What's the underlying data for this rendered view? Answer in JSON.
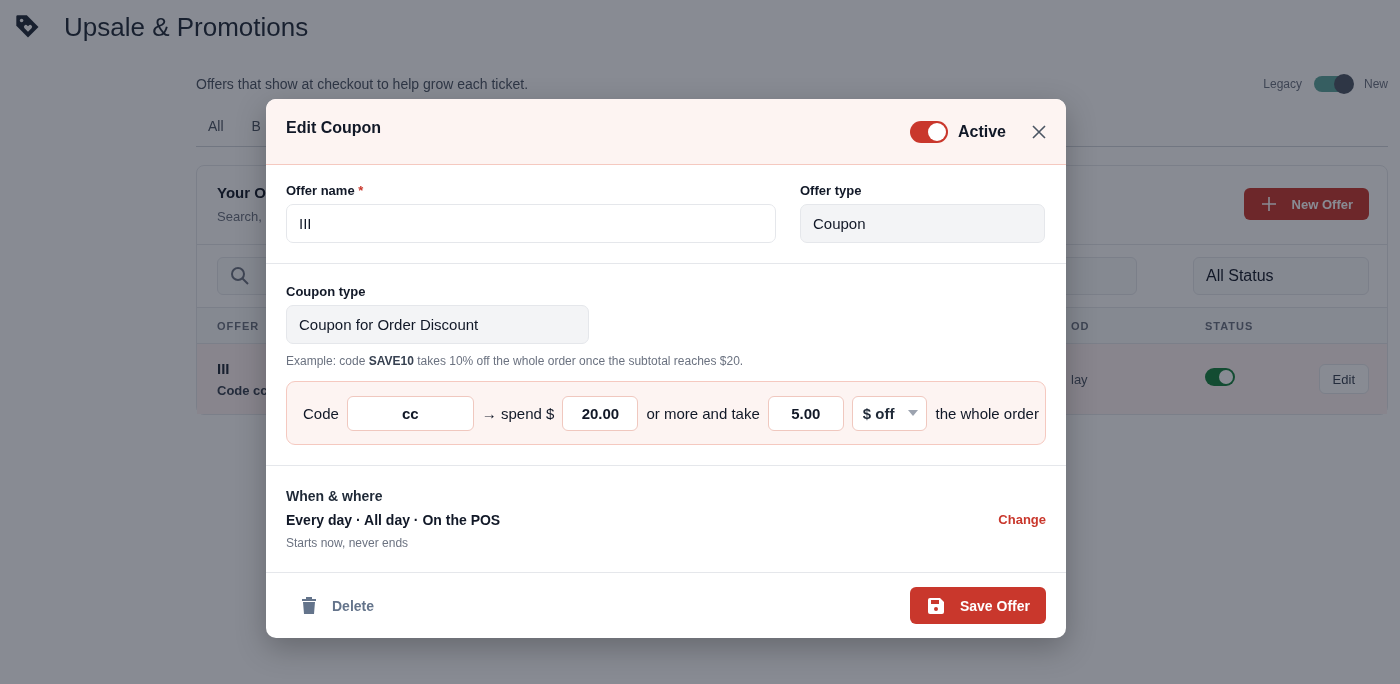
{
  "page": {
    "title": "Upsale & Promotions",
    "subtitle": "Offers that show at checkout to help grow each ticket.",
    "mode_toggle": {
      "left_label": "Legacy",
      "right_label": "New",
      "on": true
    }
  },
  "tabs": [
    {
      "label": "All"
    },
    {
      "label": "B"
    }
  ],
  "offers_card": {
    "title": "Your O",
    "subtitle": "Search,",
    "new_button": "New Offer",
    "status_filter": "All Status",
    "columns": [
      "OFFER",
      "OD",
      "STATUS"
    ],
    "rows": [
      {
        "name": "III",
        "detail": "Code cc",
        "column_3": "lay",
        "on": true,
        "action": "Edit"
      }
    ]
  },
  "modal": {
    "title": "Edit Coupon",
    "active": {
      "label": "Active",
      "on": true
    },
    "offer_name": {
      "label": "Offer name",
      "required_mark": "*",
      "value": "III"
    },
    "offer_type": {
      "label": "Offer type",
      "value": "Coupon"
    },
    "coupon_type": {
      "label": "Coupon type",
      "value": "Coupon for Order Discount",
      "hint": "Example: code **SAVE10** takes 10% off the whole order once the subtotal reaches $20."
    },
    "rule": [
      {
        "kind": "text",
        "text": "Code"
      },
      {
        "kind": "input",
        "value": "cc",
        "wide": true
      },
      {
        "kind": "text",
        "text": "→ spend $"
      },
      {
        "kind": "input",
        "value": "20.00"
      },
      {
        "kind": "text",
        "text": "or more and take"
      },
      {
        "kind": "input",
        "value": "5.00"
      },
      {
        "kind": "select",
        "value": "$ off"
      },
      {
        "kind": "text",
        "text": "the whole order"
      }
    ],
    "schedule": {
      "title": "When & where",
      "summary": "Every day · All day · On the POS",
      "detail": "Starts now, never ends",
      "change": "Change"
    },
    "delete": "Delete",
    "save": "Save Offer"
  }
}
